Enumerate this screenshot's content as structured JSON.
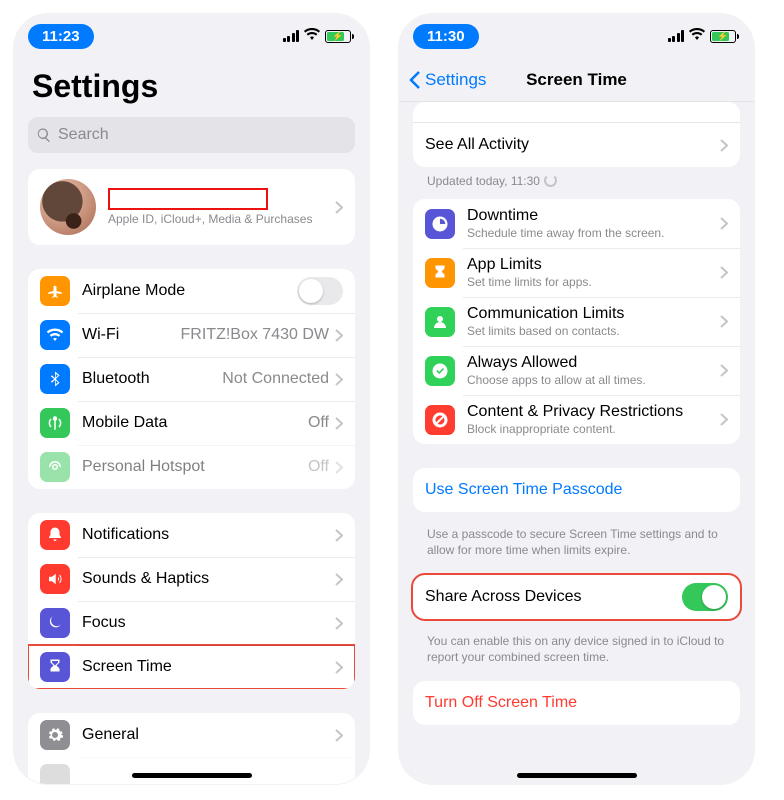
{
  "left": {
    "status": {
      "time": "11:23"
    },
    "title": "Settings",
    "search_placeholder": "Search",
    "profile": {
      "sub": "Apple ID, iCloud+, Media & Purchases"
    },
    "network": [
      {
        "icon": "airplane",
        "label": "Airplane Mode",
        "value": "",
        "switch": "off"
      },
      {
        "icon": "wifi",
        "label": "Wi-Fi",
        "value": "FRITZ!Box 7430 DW"
      },
      {
        "icon": "bluetooth",
        "label": "Bluetooth",
        "value": "Not Connected"
      },
      {
        "icon": "mobiledata",
        "label": "Mobile Data",
        "value": "Off"
      },
      {
        "icon": "hotspot",
        "label": "Personal Hotspot",
        "value": "Off",
        "dim": true
      }
    ],
    "system": [
      {
        "icon": "notifications",
        "label": "Notifications"
      },
      {
        "icon": "sounds",
        "label": "Sounds & Haptics"
      },
      {
        "icon": "focus",
        "label": "Focus"
      },
      {
        "icon": "screentime",
        "label": "Screen Time",
        "highlight": true
      }
    ],
    "general": [
      {
        "icon": "general",
        "label": "General"
      }
    ]
  },
  "right": {
    "status": {
      "time": "11:30"
    },
    "nav": {
      "back": "Settings",
      "title": "Screen Time"
    },
    "activity": {
      "label": "See All Activity",
      "updated": "Updated today, 11:30"
    },
    "limits": [
      {
        "label": "Downtime",
        "sub": "Schedule time away from the screen."
      },
      {
        "label": "App Limits",
        "sub": "Set time limits for apps."
      },
      {
        "label": "Communication Limits",
        "sub": "Set limits based on contacts."
      },
      {
        "label": "Always Allowed",
        "sub": "Choose apps to allow at all times."
      },
      {
        "label": "Content & Privacy Restrictions",
        "sub": "Block inappropriate content."
      }
    ],
    "passcode": {
      "label": "Use Screen Time Passcode",
      "note": "Use a passcode to secure Screen Time settings and to allow for more time when limits expire."
    },
    "share": {
      "label": "Share Across Devices",
      "note": "You can enable this on any device signed in to iCloud to report your combined screen time."
    },
    "turnoff": {
      "label": "Turn Off Screen Time"
    }
  }
}
